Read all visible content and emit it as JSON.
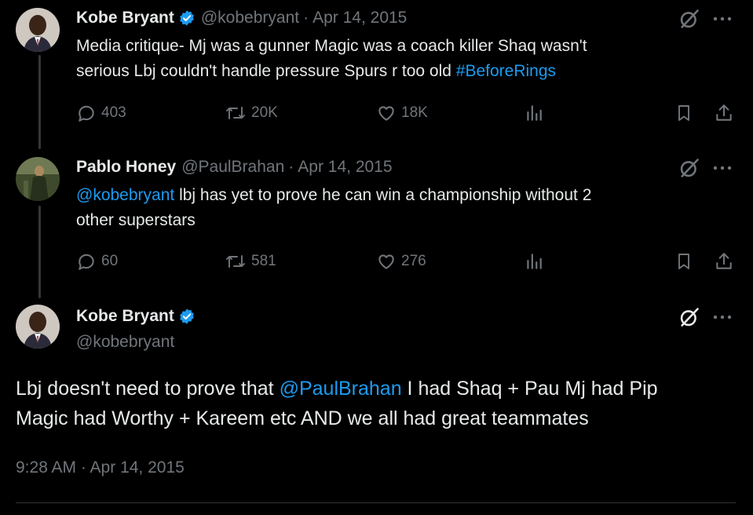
{
  "tweets": [
    {
      "name": "Kobe Bryant",
      "handle": "@kobebryant",
      "date": "Apr 14, 2015",
      "text_plain_1": "Media critique- Mj was a gunner Magic was a coach killer Shaq wasn't",
      "text_plain_2": "serious Lbj couldn't handle pressure Spurs r too old ",
      "hashtag": "#BeforeRings",
      "replies": "403",
      "retweets": "20K",
      "likes": "18K"
    },
    {
      "name": "Pablo Honey",
      "handle": "@PaulBrahan",
      "date": "Apr 14, 2015",
      "mention": "@kobebryant",
      "text_plain_1": " lbj has yet to prove he can win a championship without 2",
      "text_plain_2": "other superstars",
      "replies": "60",
      "retweets": "581",
      "likes": "276"
    }
  ],
  "main_tweet": {
    "name": "Kobe Bryant",
    "handle": "@kobebryant",
    "text_part_1": "Lbj doesn't need to prove that ",
    "mention": "@PaulBrahan",
    "text_part_2": " I had Shaq + Pau Mj had Pip",
    "text_line_2": "Magic had Worthy + Kareem etc AND we all had great teammates",
    "timestamp": "9:28 AM · Apr 14, 2015"
  },
  "separator": "·",
  "colors": {
    "background": "#000000",
    "text": "#e7e9ea",
    "muted": "#71767b",
    "link": "#1d9bf0",
    "verified": "#1d9bf0"
  },
  "icons": [
    "verified-badge-icon",
    "grok-icon",
    "more-icon",
    "reply-icon",
    "retweet-icon",
    "like-icon",
    "views-icon",
    "bookmark-icon",
    "share-icon"
  ]
}
